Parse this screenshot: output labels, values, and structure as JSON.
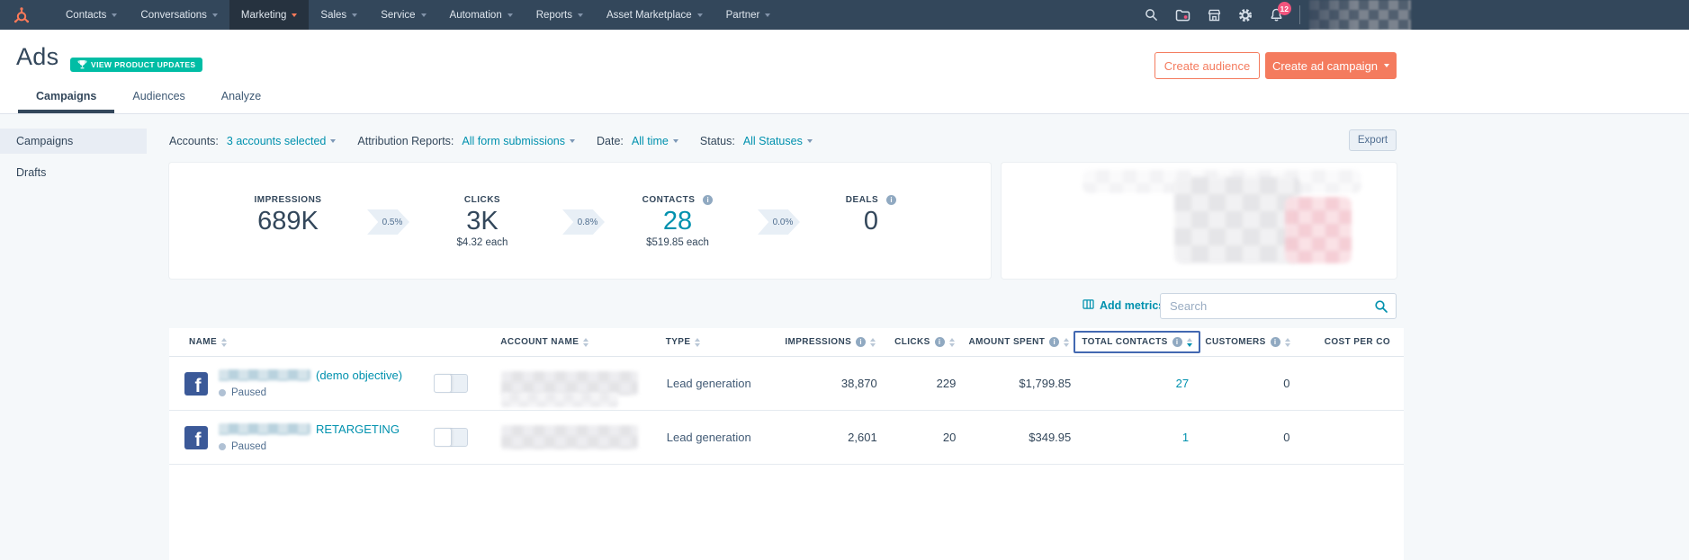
{
  "nav": {
    "items": [
      "Contacts",
      "Conversations",
      "Marketing",
      "Sales",
      "Service",
      "Automation",
      "Reports",
      "Asset Marketplace",
      "Partner"
    ],
    "active_item": "Marketing",
    "notification_count": "12"
  },
  "header": {
    "title": "Ads",
    "updates_badge": "VIEW PRODUCT UPDATES",
    "create_audience_label": "Create audience",
    "create_campaign_label": "Create ad campaign"
  },
  "tabs": [
    {
      "label": "Campaigns"
    },
    {
      "label": "Audiences"
    },
    {
      "label": "Analyze"
    }
  ],
  "sidebar": {
    "items": [
      {
        "label": "Campaigns"
      },
      {
        "label": "Drafts"
      }
    ]
  },
  "filters": {
    "accounts_label": "Accounts:",
    "accounts_value": "3 accounts selected",
    "attribution_label": "Attribution Reports:",
    "attribution_value": "All form submissions",
    "date_label": "Date:",
    "date_value": "All time",
    "status_label": "Status:",
    "status_value": "All Statuses",
    "export_label": "Export"
  },
  "metrics": {
    "impressions": {
      "label": "IMPRESSIONS",
      "value": "689K"
    },
    "clicks": {
      "label": "CLICKS",
      "value": "3K",
      "sub": "$4.32 each"
    },
    "contacts": {
      "label": "CONTACTS",
      "value": "28",
      "sub": "$519.85 each"
    },
    "deals": {
      "label": "DEALS",
      "value": "0"
    },
    "deltas": [
      "0.5%",
      "0.8%",
      "0.0%"
    ]
  },
  "toolbar": {
    "add_metrics_label": "Add metrics",
    "search_placeholder": "Search"
  },
  "table": {
    "columns": {
      "name": "NAME",
      "account_name": "ACCOUNT NAME",
      "type": "TYPE",
      "impressions": "IMPRESSIONS",
      "clicks": "CLICKS",
      "amount_spent": "AMOUNT SPENT",
      "total_contacts": "TOTAL CONTACTS",
      "customers": "CUSTOMERS",
      "cost_per_contact": "COST PER CO"
    },
    "rows": [
      {
        "name_visible": "(demo objective)",
        "status": "Paused",
        "type": "Lead generation",
        "impressions": "38,870",
        "clicks": "229",
        "amount_spent": "$1,799.85",
        "total_contacts": "27",
        "customers": "0"
      },
      {
        "name_visible": "RETARGETING",
        "status": "Paused",
        "type": "Lead generation",
        "impressions": "2,601",
        "clicks": "20",
        "amount_spent": "$349.95",
        "total_contacts": "1",
        "customers": "0"
      }
    ]
  },
  "colors": {
    "nav_bg": "#33475b",
    "accent_orange": "#f47b5e",
    "link_teal": "#0091ae",
    "badge_green": "#00bda5",
    "notification_pink": "#f2547d",
    "facebook_blue": "#3b5998",
    "column_highlight_blue": "#4268b1"
  }
}
